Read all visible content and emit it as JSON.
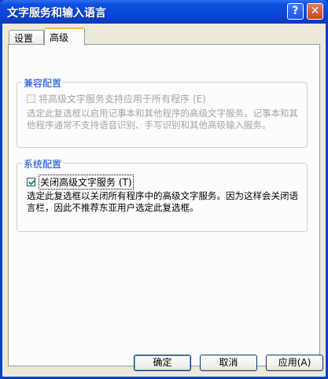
{
  "window": {
    "title": "文字服务和输入语言",
    "help_label": "?",
    "close_label": "✕"
  },
  "tabs": [
    {
      "label": "设置"
    },
    {
      "label": "高级"
    }
  ],
  "compat_group": {
    "label": "兼容配置",
    "checkbox_label": "将高级文字服务支持应用于所有程序 (E)",
    "checked": false,
    "enabled": false,
    "description": "选定此复选框以启用记事本和其他程序的高级文字服务。记事本和其他程序通常不支持语音识别、手写识别和其他高级输入服务。"
  },
  "system_group": {
    "label": "系统配置",
    "checkbox_label": "关闭高级文字服务 (T)",
    "checked": true,
    "description": "选定此复选框以关闭所有程序中的高级文字服务。因为这样会关闭语言栏，因此不推荐东亚用户选定此复选框。"
  },
  "buttons": {
    "ok": "确定",
    "cancel": "取消",
    "apply": "应用(A)"
  }
}
